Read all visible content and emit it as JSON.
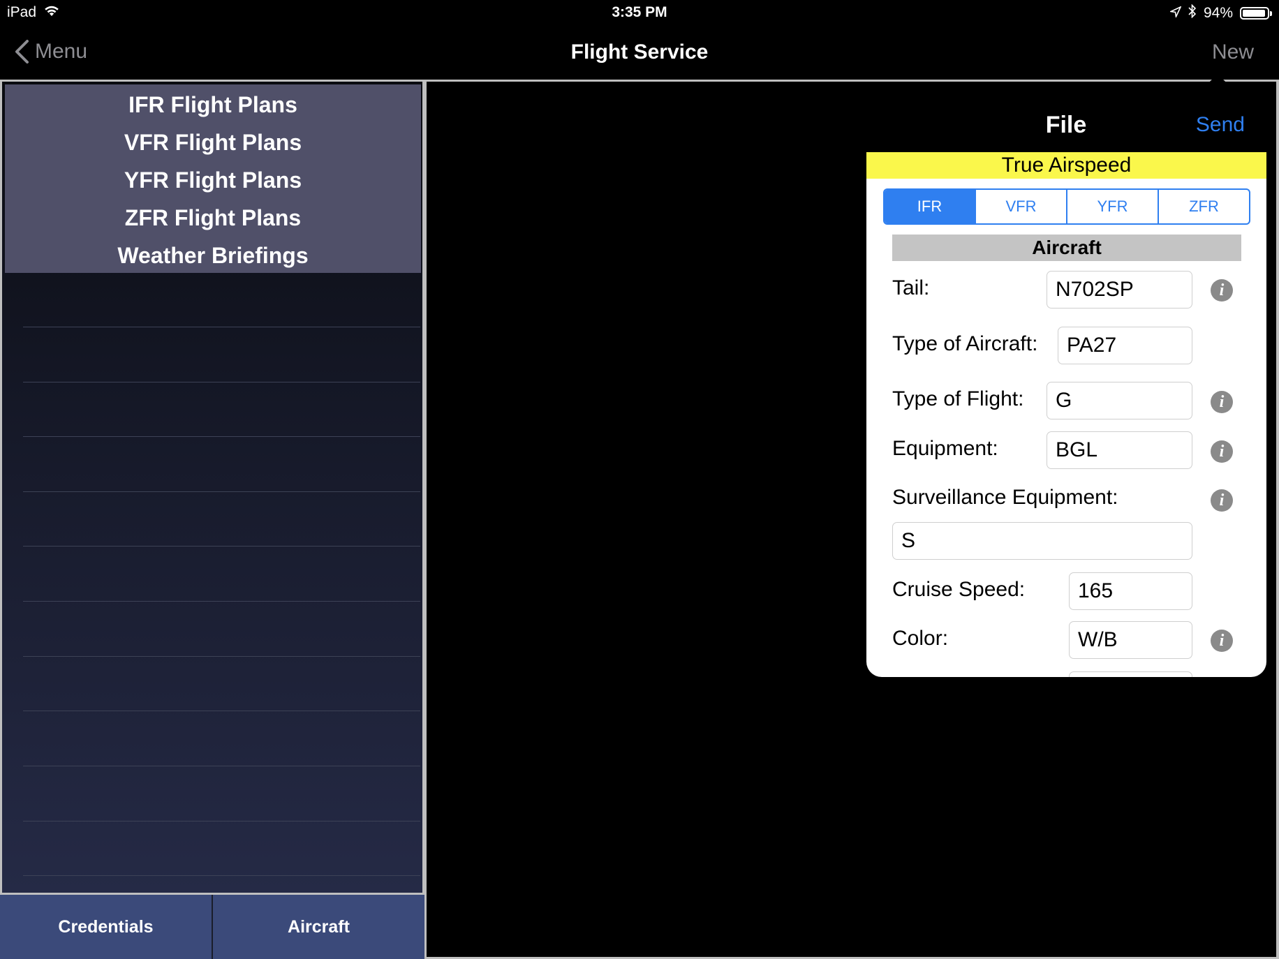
{
  "status_bar": {
    "device": "iPad",
    "time": "3:35 PM",
    "battery": "94%",
    "battery_level": 0.94,
    "icons": [
      "wifi-icon",
      "location-arrow-icon",
      "bluetooth-icon",
      "battery-icon"
    ]
  },
  "nav": {
    "back_label": "Menu",
    "title": "Flight Service",
    "right_label": "New"
  },
  "sidebar": {
    "items": [
      {
        "label": "IFR Flight Plans"
      },
      {
        "label": "VFR Flight Plans"
      },
      {
        "label": "YFR Flight Plans"
      },
      {
        "label": "ZFR Flight Plans"
      },
      {
        "label": "Weather Briefings"
      }
    ]
  },
  "bottom_bar": {
    "credentials": "Credentials",
    "aircraft": "Aircraft"
  },
  "popover": {
    "title": "File",
    "send": "Send",
    "banner": "True Airspeed",
    "segments": [
      "IFR",
      "VFR",
      "YFR",
      "ZFR"
    ],
    "selected_segment": "IFR",
    "section_title": "Aircraft",
    "fields": {
      "tail": {
        "label": "Tail:",
        "value": "N702SP"
      },
      "type_of_aircraft": {
        "label": "Type of Aircraft:",
        "value": "PA27"
      },
      "type_of_flight": {
        "label": "Type of Flight:",
        "value": "G"
      },
      "equipment": {
        "label": "Equipment:",
        "value": "BGL"
      },
      "surveillance": {
        "label": "Surveillance Equipment:",
        "value": "S"
      },
      "cruise_speed": {
        "label": "Cruise Speed:",
        "value": "165"
      },
      "color": {
        "label": "Color:",
        "value": "W/B"
      }
    },
    "info_glyph": "i"
  },
  "colors": {
    "accent": "#2f7ff0",
    "banner": "#faf74b",
    "sidebar_menu": "#505069",
    "bottom_bar": "#3b4a7a",
    "section_header": "#c4c4c4"
  }
}
